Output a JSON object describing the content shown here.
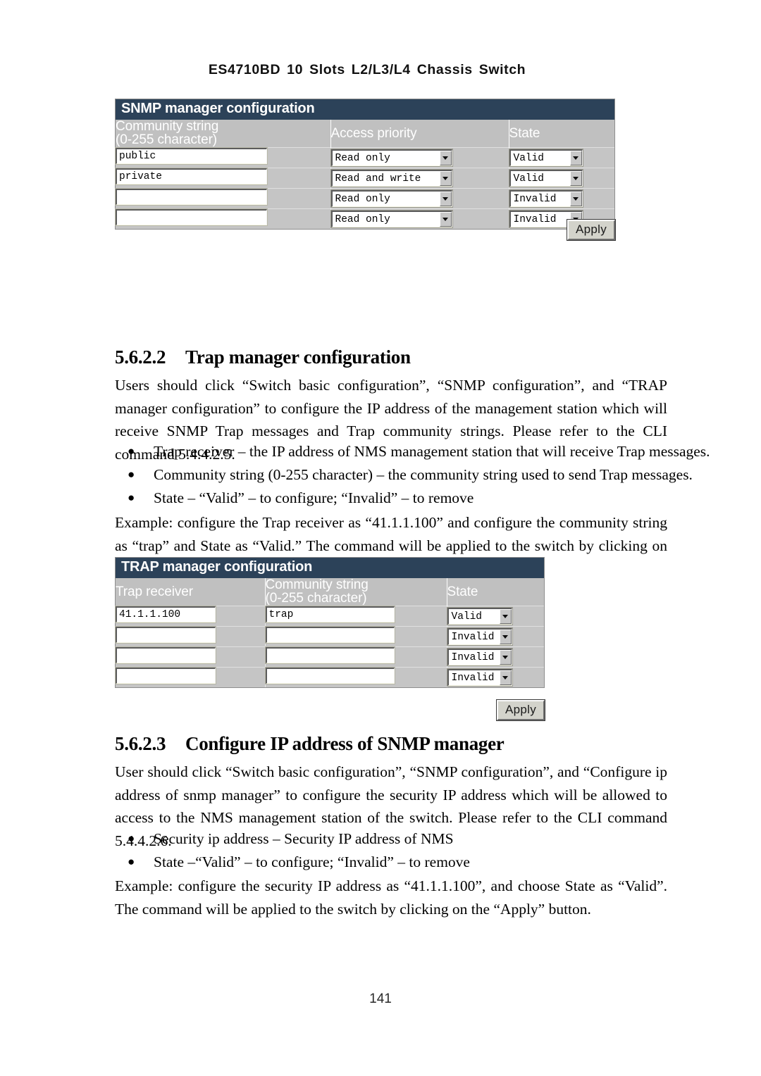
{
  "document": {
    "running_header": "ES4710BD 10 Slots L2/L3/L4 Chassis Switch",
    "page_number": "141"
  },
  "snmp_panel": {
    "title": "SNMP manager configuration",
    "columns": {
      "community": {
        "line1": "Community string",
        "line2": "(0-255 character)"
      },
      "access": "Access priority",
      "state": "State"
    },
    "rows": [
      {
        "community": "public",
        "access": "Read only",
        "state": "Valid"
      },
      {
        "community": "private",
        "access": "Read and write",
        "state": "Valid"
      },
      {
        "community": "",
        "access": "Read only",
        "state": "Invalid"
      },
      {
        "community": "",
        "access": "Read only",
        "state": "Invalid"
      }
    ],
    "apply_label": "Apply"
  },
  "trap_panel": {
    "title": "TRAP manager configuration",
    "columns": {
      "receiver": "Trap receiver",
      "community": {
        "line1": "Community string",
        "line2": "(0-255 character)"
      },
      "state": "State"
    },
    "rows": [
      {
        "receiver": "41.1.1.100",
        "community": "trap",
        "state": "Valid"
      },
      {
        "receiver": "",
        "community": "",
        "state": "Invalid"
      },
      {
        "receiver": "",
        "community": "",
        "state": "Invalid"
      },
      {
        "receiver": "",
        "community": "",
        "state": "Invalid"
      }
    ],
    "apply_label": "Apply"
  },
  "section_5622": {
    "number": "5.6.2.2",
    "title": "Trap manager configuration",
    "intro": "Users should click “Switch basic configuration”, “SNMP configuration”, and “TRAP manager configuration” to configure the IP address of the management station which will receive SNMP Trap messages and Trap community strings. Please refer to the CLI command 5.4.4.2.5.",
    "bullets": [
      "Trap receiver – the IP address of NMS management station that will receive Trap messages.",
      "Community string (0-255 character) – the community string used to send Trap messages.",
      "State – “Valid” – to configure; “Invalid” – to remove"
    ],
    "example": "Example: configure the Trap receiver as “41.1.1.100” and configure the community string as “trap” and State as “Valid.” The command will be applied to the switch by clicking on the “Apply” button."
  },
  "section_5623": {
    "number": "5.6.2.3",
    "title": "Configure IP address of SNMP manager",
    "intro": "User should click “Switch basic configuration”, “SNMP configuration”, and “Configure ip address of snmp manager” to configure the security IP address which will be allowed to access to the NMS management station of the switch. Please refer to the CLI command 5.4.4.2.6.",
    "bullets": [
      "Security ip address – Security IP address of NMS",
      "State –“Valid” – to configure; “Invalid” – to remove"
    ],
    "example": "Example: configure the security IP address as “41.1.1.100”, and choose State as “Valid”. The command will be applied to the switch by clicking on the “Apply” button."
  },
  "icons": {
    "bullet": "●",
    "dropdown_arrow": "chevron-down-icon"
  },
  "colors": {
    "panel_title_bg": "#2c4259",
    "panel_bg": "#c5c5c5",
    "header_cell_bg": "#c0c0c0",
    "header_text": "#ffffff"
  }
}
